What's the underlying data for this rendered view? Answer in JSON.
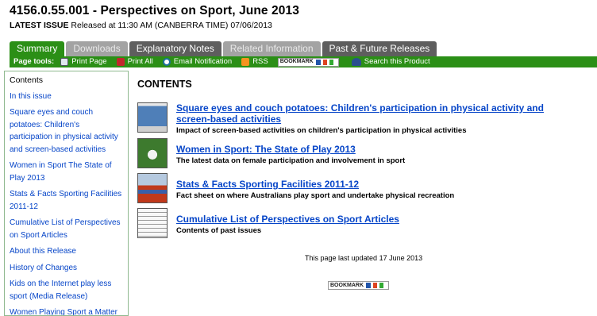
{
  "header": {
    "title": "4156.0.55.001 - Perspectives on Sport, June 2013",
    "latest_issue_label": "LATEST ISSUE",
    "release_text": " Released at 11:30 AM (CANBERRA TIME) 07/06/2013"
  },
  "tabs": [
    {
      "label": "Summary",
      "state": "active"
    },
    {
      "label": "Downloads",
      "state": "disabled"
    },
    {
      "label": "Explanatory Notes",
      "state": "normal"
    },
    {
      "label": "Related Information",
      "state": "disabled"
    },
    {
      "label": "Past & Future Releases",
      "state": "normal"
    }
  ],
  "toolbar": {
    "label": "Page tools:",
    "print_page": "Print Page",
    "print_all": "Print All",
    "email_notification": "Email Notification",
    "rss": "RSS",
    "bookmark": "BOOKMARK",
    "search": "Search this Product"
  },
  "sidebar": {
    "heading": "Contents",
    "items": [
      "In this issue",
      "Square eyes and couch potatoes: Children's participation in physical activity and screen-based activities",
      "Women in Sport The State of Play 2013",
      "Stats & Facts Sporting Facilities 2011-12",
      "Cumulative List of Perspectives on Sport Articles",
      "About this Release",
      "History of Changes",
      "Kids on the Internet play less sport (Media Release)",
      "Women Playing Sport a Matter of Degree (Media Release)"
    ]
  },
  "main": {
    "heading": "CONTENTS",
    "items": [
      {
        "title": "Square eyes and couch potatoes: Children's participation in physical activity and screen-based activities",
        "description": "Impact of screen-based activities on children's participation in physical activities"
      },
      {
        "title": "Women in Sport: The State of Play 2013",
        "description": "The latest data on female participation and involvement in sport"
      },
      {
        "title": "Stats & Facts Sporting Facilities 2011-12",
        "description": "Fact sheet on where Australians play sport and undertake physical recreation"
      },
      {
        "title": "Cumulative List of Perspectives on Sport Articles",
        "description": "Contents of past issues"
      }
    ],
    "last_updated": "This page last updated 17 June 2013",
    "bookmark": "BOOKMARK"
  },
  "colors": {
    "accent_green": "#2b8f16",
    "link_blue": "#0645c8",
    "tab_gray": "#5e5e5e"
  }
}
